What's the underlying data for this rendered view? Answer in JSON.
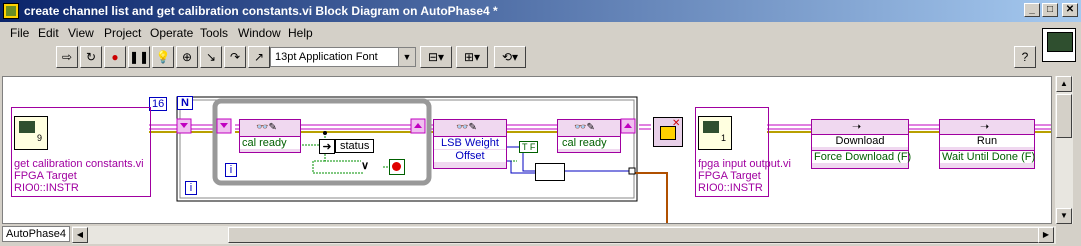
{
  "window": {
    "title": "create channel list and get calibration constants.vi Block Diagram on AutoPhase4 *",
    "minimize": "_",
    "maximize": "□",
    "close": "✕"
  },
  "menu": [
    "File",
    "Edit",
    "View",
    "Project",
    "Operate",
    "Tools",
    "Window",
    "Help"
  ],
  "toolbar": {
    "font_select": "13pt Application Font",
    "help_button": "?"
  },
  "diagram": {
    "loop_count_constant": "16",
    "loop_count_terminal": "N",
    "iteration_terminal_outer": "i",
    "iteration_terminal_inner": "i",
    "subvi_left": {
      "icon_number": "9",
      "lines": [
        "get calibration constants.vi",
        "FPGA Target",
        "RIO0::INSTR"
      ]
    },
    "cal_ready_read": "cal ready",
    "status_label": "status",
    "lsb_weight": "LSB Weight",
    "offset": "Offset",
    "true_constant": "T F",
    "cal_ready_write": "cal ready",
    "subvi_right": {
      "icon_number": "1",
      "lines": [
        "fpga input output.vi",
        "FPGA Target",
        "RIO0::INSTR"
      ]
    },
    "download_node": {
      "title": "Download",
      "param": "Force Download (F)"
    },
    "run_node": {
      "title": "Run",
      "param": "Wait Until Done (F)"
    }
  },
  "statusbar": {
    "target": "AutoPhase4"
  }
}
